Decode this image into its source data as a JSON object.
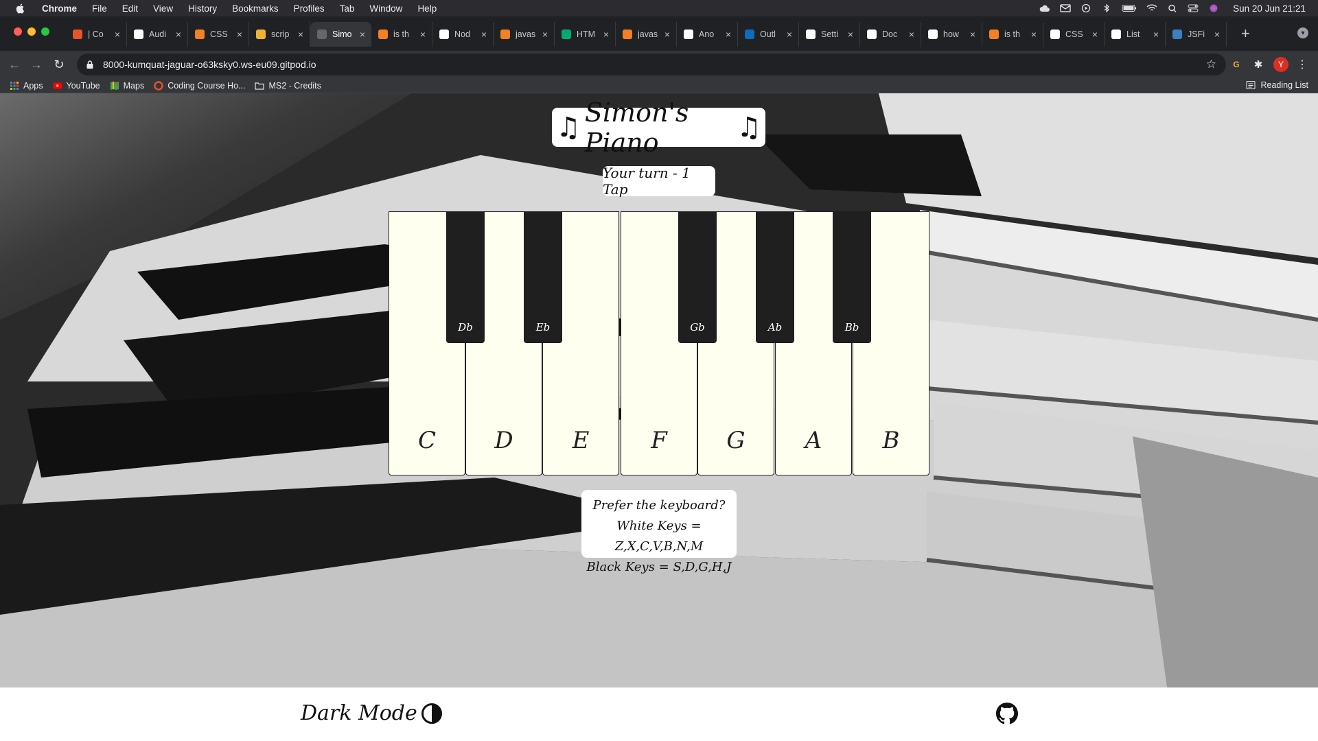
{
  "menubar": {
    "app": "Chrome",
    "items": [
      "File",
      "Edit",
      "View",
      "History",
      "Bookmarks",
      "Profiles",
      "Tab",
      "Window",
      "Help"
    ],
    "clock": "Sun 20 Jun  21:21"
  },
  "tabs": [
    {
      "label": "| Co",
      "color": "#e8532b"
    },
    {
      "label": "Audi",
      "color": "#ffffff"
    },
    {
      "label": "CSS",
      "color": "#f48024"
    },
    {
      "label": "scrip",
      "color": "#f2b134"
    },
    {
      "label": "Simo",
      "color": "#666666"
    },
    {
      "label": "is th",
      "color": "#f48024"
    },
    {
      "label": "Nod",
      "color": "#ffffff"
    },
    {
      "label": "javas",
      "color": "#f48024"
    },
    {
      "label": "HTM",
      "color": "#04aa6d"
    },
    {
      "label": "javas",
      "color": "#f48024"
    },
    {
      "label": "Ano",
      "color": "#ffffff"
    },
    {
      "label": "Outl",
      "color": "#0f6cbd"
    },
    {
      "label": "Setti",
      "color": "#ffffff"
    },
    {
      "label": "Doc",
      "color": "#ffffff"
    },
    {
      "label": "how",
      "color": "#ffffff"
    },
    {
      "label": "is th",
      "color": "#f48024"
    },
    {
      "label": "CSS",
      "color": "#ffffff"
    },
    {
      "label": "List",
      "color": "#ffffff"
    },
    {
      "label": "JSFi",
      "color": "#3d7fc7"
    }
  ],
  "active_tab_index": 4,
  "address": {
    "url": "8000-kumquat-jaguar-o63ksky0.ws-eu09.gitpod.io"
  },
  "profile_initial": "Y",
  "bookmarks": {
    "items": [
      "Apps",
      "YouTube",
      "Maps",
      "Coding Course Ho...",
      "MS2 - Credits"
    ],
    "reading_list": "Reading List"
  },
  "page": {
    "title": "Simon's Piano",
    "turn_text": "Your turn - 1 Tap",
    "white_keys": [
      "C",
      "D",
      "E",
      "F",
      "G",
      "A",
      "B"
    ],
    "black_keys": [
      "Db",
      "Eb",
      "Gb",
      "Ab",
      "Bb"
    ],
    "help_lines": [
      "Prefer the keyboard?",
      "White Keys = Z,X,C,V,B,N,M",
      "Black Keys = S,D,G,H,J"
    ]
  },
  "footer": {
    "dark_mode_label": "Dark Mode",
    "github_icon": "github-icon"
  }
}
